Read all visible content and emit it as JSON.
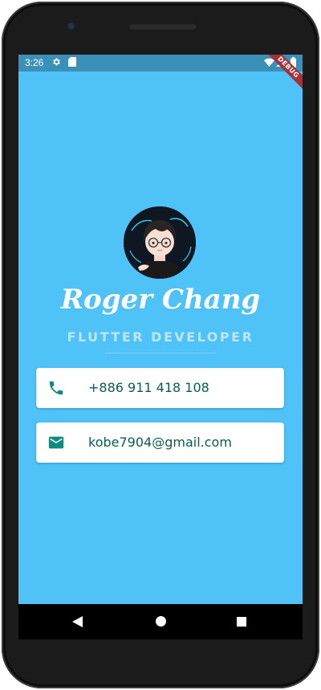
{
  "status_bar": {
    "time": "3:26",
    "icons": [
      "gear-icon",
      "sd-card-icon",
      "wifi-icon",
      "signal-icon",
      "battery-icon"
    ]
  },
  "debug_banner": {
    "label": "DEBUG",
    "color": "#a3313b"
  },
  "profile": {
    "avatar_icon": "avatar-illustration",
    "name": "Roger Chang",
    "role": "FLUTTER DEVELOPER"
  },
  "contacts": [
    {
      "icon": "phone-icon",
      "text": "+886 911 418 108"
    },
    {
      "icon": "email-icon",
      "text": "kobe7904@gmail.com"
    }
  ],
  "colors": {
    "background": "#4fc3f7",
    "status_bar": "#3a90b6",
    "card_text": "#0b5b57",
    "icon_teal": "#0f8a80",
    "role_text": "#bfe6f7"
  },
  "navigation": {
    "buttons": [
      "back-icon",
      "home-icon",
      "recents-icon"
    ]
  }
}
